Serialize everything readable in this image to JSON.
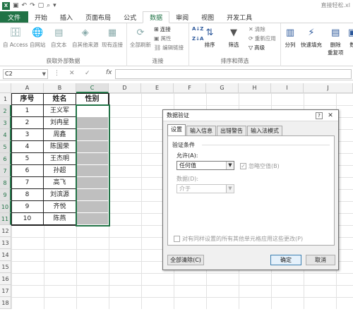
{
  "window": {
    "title": "直接轻松.xl"
  },
  "ribbon_tabs": [
    "文件",
    "开始",
    "插入",
    "页面布局",
    "公式",
    "数据",
    "审阅",
    "视图",
    "开发工具"
  ],
  "ribbon": {
    "get_external": {
      "buttons": [
        "自 Access",
        "自网站",
        "自文本",
        "自其他来源",
        "现有连接"
      ],
      "label": "获取外部数据"
    },
    "connections": {
      "refresh_all": "全部刷新",
      "connections": "连接",
      "properties": "属性",
      "edit_links": "编辑链接",
      "label": "连接"
    },
    "sort_filter": {
      "sort": "排序",
      "filter": "筛选",
      "clear": "清除",
      "reapply": "重新应用",
      "advanced": "高级",
      "label": "排序和筛选"
    },
    "data_tools": {
      "split": "分列",
      "flash_fill": "快速填充",
      "remove_dup_1": "删除",
      "remove_dup_2": "重复项",
      "more": "数"
    }
  },
  "formula_bar": {
    "name_box": "C2",
    "fx": "fx"
  },
  "columns": [
    "A",
    "B",
    "C",
    "D",
    "E",
    "F",
    "G",
    "H",
    "I",
    "J"
  ],
  "rows": [
    "1",
    "2",
    "3",
    "4",
    "5",
    "6",
    "7",
    "8",
    "9",
    "10",
    "11",
    "12",
    "13",
    "14",
    "15",
    "16",
    "17",
    "18"
  ],
  "table": {
    "headers": [
      "序号",
      "姓名",
      "性别"
    ],
    "rows": [
      [
        "1",
        "王义军"
      ],
      [
        "2",
        "刘冉星"
      ],
      [
        "3",
        "周鑫"
      ],
      [
        "4",
        "陈国荣"
      ],
      [
        "5",
        "王杰明"
      ],
      [
        "6",
        "孙超"
      ],
      [
        "7",
        "高飞"
      ],
      [
        "8",
        "刘滨源"
      ],
      [
        "9",
        "齐悦"
      ],
      [
        "10",
        "陈燕"
      ]
    ]
  },
  "dialog": {
    "title": "数据验证",
    "tabs": [
      "设置",
      "输入信息",
      "出错警告",
      "输入法模式"
    ],
    "section": "验证条件",
    "allow_label": "允许(A):",
    "allow_value": "任何值",
    "ignore_blank": "忽略空值(B)",
    "data_label": "数据(D):",
    "data_value": "介于",
    "apply_all": "对有同样设置的所有其他单元格应用这些更改(P)",
    "clear_all": "全部清除(C)",
    "ok": "确定",
    "cancel": "取消"
  },
  "colors": {
    "accent": "#217346",
    "selected_fill": "#bfbfbf"
  }
}
